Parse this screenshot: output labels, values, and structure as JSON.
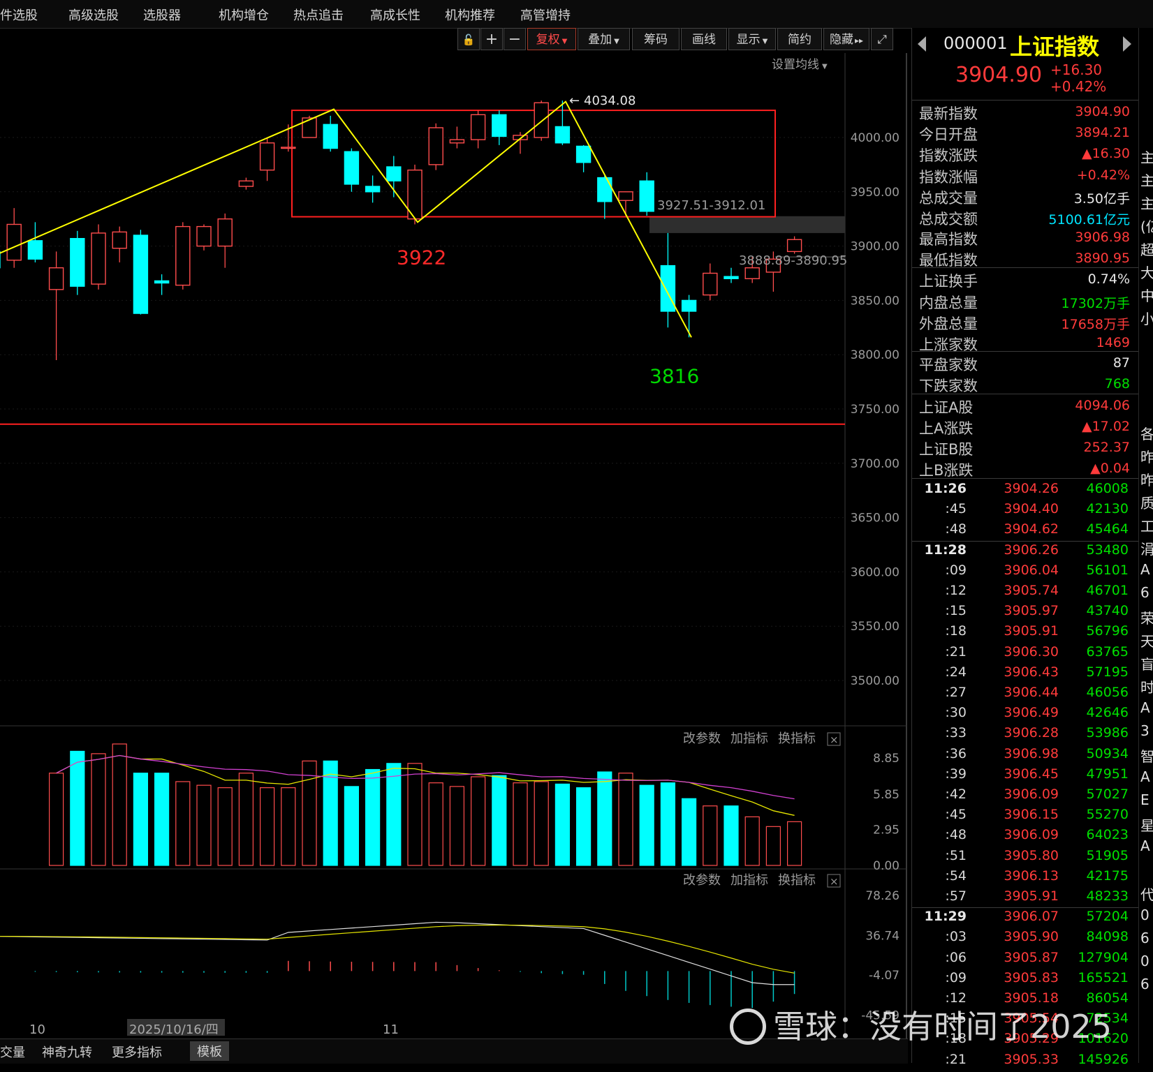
{
  "nav": {
    "items": [
      "条件选股",
      "高级选股",
      "选股器",
      "机构增仓",
      "热点追击",
      "高成长性",
      "机构推荐",
      "高管增持"
    ]
  },
  "toolbar": {
    "buttons": [
      "复权",
      "叠加",
      "筹码",
      "画线",
      "显示",
      "简约",
      "隐藏"
    ],
    "lock_icon": "lock-icon",
    "zoom_in": "+",
    "zoom_out": "−",
    "fullscreen_icon": "fullscreen-icon"
  },
  "main_chart": {
    "ma_setting_label": "设置均线",
    "price_axis": [
      "4000.00",
      "3950.00",
      "3900.00",
      "3850.00",
      "3800.00",
      "3750.00",
      "3700.00",
      "3650.00",
      "3600.00",
      "3550.00",
      "3500.00"
    ],
    "annotations": {
      "high": "4034.08",
      "low_left": "3922",
      "low_right": "3816",
      "gap_upper": "3927.51-3912.01",
      "gap_lower": "3888.89-3890.95"
    },
    "colors": {
      "up": "#ff4d4d",
      "down": "#00ffff",
      "zigzag": "#ffff00",
      "box": "#ff2020",
      "hline": "#ff2020"
    }
  },
  "candles": [
    {
      "o": 3895,
      "h": 3902,
      "l": 3875,
      "c": 3880
    },
    {
      "o": 3887,
      "h": 3935,
      "l": 3880,
      "c": 3920
    },
    {
      "o": 3905,
      "h": 3922,
      "l": 3885,
      "c": 3888
    },
    {
      "o": 3860,
      "h": 3895,
      "l": 3795,
      "c": 3880
    },
    {
      "o": 3907,
      "h": 3914,
      "l": 3855,
      "c": 3863
    },
    {
      "o": 3865,
      "h": 3920,
      "l": 3860,
      "c": 3912
    },
    {
      "o": 3898,
      "h": 3918,
      "l": 3885,
      "c": 3913
    },
    {
      "o": 3910,
      "h": 3915,
      "l": 3837,
      "c": 3838
    },
    {
      "o": 3868,
      "h": 3874,
      "l": 3855,
      "c": 3866
    },
    {
      "o": 3864,
      "h": 3922,
      "l": 3860,
      "c": 3918
    },
    {
      "o": 3900,
      "h": 3920,
      "l": 3896,
      "c": 3918
    },
    {
      "o": 3900,
      "h": 3930,
      "l": 3880,
      "c": 3925
    },
    {
      "o": 3955,
      "h": 3963,
      "l": 3952,
      "c": 3960
    },
    {
      "o": 3970,
      "h": 4000,
      "l": 3960,
      "c": 3995
    },
    {
      "o": 3990,
      "h": 4012,
      "l": 3987,
      "c": 3991
    },
    {
      "o": 4000,
      "h": 4020,
      "l": 4000,
      "c": 4018
    },
    {
      "o": 4012,
      "h": 4020,
      "l": 3987,
      "c": 3990
    },
    {
      "o": 3987,
      "h": 3990,
      "l": 3950,
      "c": 3957
    },
    {
      "o": 3955,
      "h": 3965,
      "l": 3940,
      "c": 3950
    },
    {
      "o": 3973,
      "h": 3983,
      "l": 3945,
      "c": 3960
    },
    {
      "o": 3925,
      "h": 3975,
      "l": 3920,
      "c": 3970
    },
    {
      "o": 3975,
      "h": 4013,
      "l": 3970,
      "c": 4009
    },
    {
      "o": 3995,
      "h": 4010,
      "l": 3990,
      "c": 3998
    },
    {
      "o": 3998,
      "h": 4025,
      "l": 3990,
      "c": 4021
    },
    {
      "o": 4021,
      "h": 4025,
      "l": 3993,
      "c": 4001
    },
    {
      "o": 3998,
      "h": 4005,
      "l": 3985,
      "c": 4002
    },
    {
      "o": 4000,
      "h": 4034,
      "l": 3997,
      "c": 4032
    },
    {
      "o": 4010,
      "h": 4034,
      "l": 3993,
      "c": 3995
    },
    {
      "o": 3992,
      "h": 3993,
      "l": 3968,
      "c": 3977
    },
    {
      "o": 3963,
      "h": 3965,
      "l": 3925,
      "c": 3941
    },
    {
      "o": 3942,
      "h": 3950,
      "l": 3928,
      "c": 3950
    },
    {
      "o": 3960,
      "h": 3968,
      "l": 3928,
      "c": 3932
    },
    {
      "o": 3882,
      "h": 3912,
      "l": 3825,
      "c": 3840
    },
    {
      "o": 3850,
      "h": 3855,
      "l": 3816,
      "c": 3840
    },
    {
      "o": 3855,
      "h": 3884,
      "l": 3850,
      "c": 3875
    },
    {
      "o": 3872,
      "h": 3880,
      "l": 3866,
      "c": 3870
    },
    {
      "o": 3870,
      "h": 3890,
      "l": 3866,
      "c": 3880
    },
    {
      "o": 3876,
      "h": 3895,
      "l": 3858,
      "c": 3888
    },
    {
      "o": 3895,
      "h": 3909,
      "l": 3893,
      "c": 3906
    }
  ],
  "volume_panel": {
    "buttons": [
      "改参数",
      "加指标",
      "换指标"
    ],
    "axis": [
      "8.85",
      "5.85",
      "2.95",
      "0.00"
    ],
    "values": [
      7.6,
      9.4,
      9.2,
      10.0,
      7.6,
      7.6,
      6.9,
      6.6,
      6.4,
      7.6,
      6.4,
      6.4,
      8.6,
      8.6,
      6.5,
      7.9,
      8.4,
      8.4,
      6.8,
      6.5,
      7.3,
      7.4,
      6.8,
      6.9,
      6.7,
      6.4,
      7.7,
      7.6,
      6.6,
      6.8,
      5.5,
      4.9,
      4.9,
      4.0,
      3.2,
      3.6
    ]
  },
  "macd_panel": {
    "buttons": [
      "改参数",
      "加指标",
      "换指标"
    ],
    "axis": [
      "78.26",
      "36.74",
      "-4.07",
      "-45.59"
    ]
  },
  "x_axis": {
    "labels": [
      "10",
      "2025/10/16/四",
      "11"
    ]
  },
  "bottom_bar": {
    "items": [
      "成交量",
      "神奇九转",
      "更多指标",
      "模板"
    ]
  },
  "quote": {
    "code": "000001",
    "name": "上证指数",
    "price": "3904.90",
    "change": "+16.30",
    "change_pct": "+0.42%",
    "rows": [
      {
        "label": "最新指数",
        "value": "3904.90",
        "color": "red"
      },
      {
        "label": "今日开盘",
        "value": "3894.21",
        "color": "red"
      },
      {
        "label": "指数涨跌",
        "value": "▲16.30",
        "color": "red"
      },
      {
        "label": "指数涨幅",
        "value": "+0.42%",
        "color": "red"
      },
      {
        "label": "总成交量",
        "value": "3.50亿手",
        "color": "white"
      },
      {
        "label": "总成交额",
        "value": "5100.61亿元",
        "color": "cyan"
      },
      {
        "label": "最高指数",
        "value": "3906.98",
        "color": "red"
      },
      {
        "label": "最低指数",
        "value": "3890.95",
        "color": "red"
      },
      {
        "label": "上证换手",
        "value": "0.74%",
        "color": "white"
      },
      {
        "label": "内盘总量",
        "value": "17302万手",
        "color": "green"
      },
      {
        "label": "外盘总量",
        "value": "17658万手",
        "color": "red"
      },
      {
        "label": "上涨家数",
        "value": "1469",
        "color": "red"
      },
      {
        "label": "平盘家数",
        "value": "87",
        "color": "white"
      },
      {
        "label": "下跌家数",
        "value": "768",
        "color": "green"
      },
      {
        "label": "上证A股",
        "value": "4094.06",
        "color": "red"
      },
      {
        "label": "上A涨跌",
        "value": "▲17.02",
        "color": "red"
      },
      {
        "label": "上证B股",
        "value": "252.37",
        "color": "red"
      },
      {
        "label": "上B涨跌",
        "value": "▲0.04",
        "color": "red"
      }
    ]
  },
  "ticks": [
    {
      "t": "11:26",
      "p": "3904.26",
      "v": "46008",
      "big": true
    },
    {
      "t": ":45",
      "p": "3904.40",
      "v": "42130"
    },
    {
      "t": ":48",
      "p": "3904.62",
      "v": "45464"
    },
    {
      "t": "11:28",
      "p": "3906.26",
      "v": "53480",
      "big": true
    },
    {
      "t": ":09",
      "p": "3906.04",
      "v": "56101"
    },
    {
      "t": ":12",
      "p": "3905.74",
      "v": "46701"
    },
    {
      "t": ":15",
      "p": "3905.97",
      "v": "43740"
    },
    {
      "t": ":18",
      "p": "3905.91",
      "v": "56796"
    },
    {
      "t": ":21",
      "p": "3906.30",
      "v": "63765"
    },
    {
      "t": ":24",
      "p": "3906.43",
      "v": "57195"
    },
    {
      "t": ":27",
      "p": "3906.44",
      "v": "46056"
    },
    {
      "t": ":30",
      "p": "3906.49",
      "v": "42646"
    },
    {
      "t": ":33",
      "p": "3906.28",
      "v": "53986"
    },
    {
      "t": ":36",
      "p": "3906.98",
      "v": "50934"
    },
    {
      "t": ":39",
      "p": "3906.45",
      "v": "47951"
    },
    {
      "t": ":42",
      "p": "3906.09",
      "v": "57027"
    },
    {
      "t": ":45",
      "p": "3906.15",
      "v": "55270"
    },
    {
      "t": ":48",
      "p": "3906.09",
      "v": "64023"
    },
    {
      "t": ":51",
      "p": "3905.80",
      "v": "51905"
    },
    {
      "t": ":54",
      "p": "3906.13",
      "v": "42175"
    },
    {
      "t": ":57",
      "p": "3905.91",
      "v": "48233"
    },
    {
      "t": "11:29",
      "p": "3906.07",
      "v": "57204",
      "big": true
    },
    {
      "t": ":03",
      "p": "3905.90",
      "v": "84098"
    },
    {
      "t": ":06",
      "p": "3905.87",
      "v": "127904"
    },
    {
      "t": ":09",
      "p": "3905.83",
      "v": "165521"
    },
    {
      "t": ":12",
      "p": "3905.18",
      "v": "86054"
    },
    {
      "t": ":15",
      "p": "3905.54",
      "v": "72534"
    },
    {
      "t": ":18",
      "p": "3905.29",
      "v": "101620"
    },
    {
      "t": ":21",
      "p": "3905.33",
      "v": "145926"
    }
  ],
  "edge_chars": [
    "主",
    "主",
    "主",
    "(亿",
    "超",
    "大",
    "中",
    "小",
    "",
    "",
    "",
    "",
    "各",
    "昨",
    "昨",
    "质",
    "工",
    "涓",
    "A",
    "6",
    "荣",
    "天",
    "盲",
    "时",
    "A",
    "3",
    "智",
    "A",
    "E",
    "星",
    "A",
    "",
    "代",
    "0",
    "6",
    "0",
    "6"
  ],
  "watermark": "雪球：没有时间了2025"
}
